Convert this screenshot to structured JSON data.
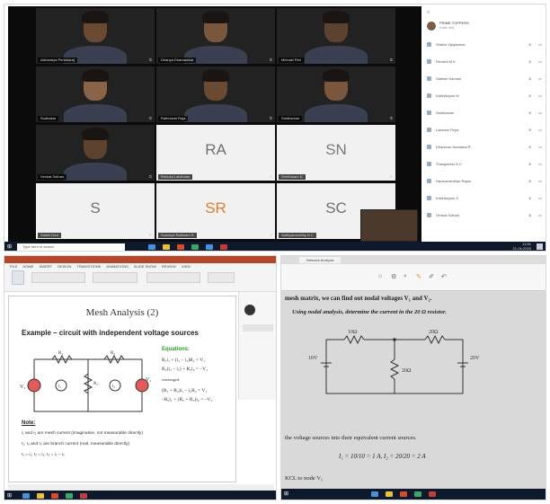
{
  "meeting": {
    "tiles": [
      {
        "label": "Aishwarya Perinbaraj",
        "initials": ""
      },
      {
        "label": "Dhanya Dhanasekar",
        "initials": ""
      },
      {
        "label": "Michael Rini",
        "initials": ""
      },
      {
        "label": "Sudhakar",
        "initials": ""
      },
      {
        "label": "Rathnavel Raja",
        "initials": ""
      },
      {
        "label": "Saidharsan",
        "initials": ""
      },
      {
        "label": "Venkat Suthan",
        "initials": ""
      },
      {
        "label": "Renuka Lakshnan",
        "initials": "RA"
      },
      {
        "label": "Seetharam N",
        "initials": "SN"
      },
      {
        "label": "Sakthi Devi",
        "initials": "S"
      },
      {
        "label": "Sowmya Rathnam R",
        "initials": "SR"
      },
      {
        "label": "Sathiyamoorthy N C",
        "initials": "SC"
      }
    ],
    "initial_colors": {
      "RA": "#6f6f6f",
      "SN": "#7a7a7a",
      "S": "#6f6f6f",
      "SR": "#e07b2f",
      "SC": "#6f6f6f"
    },
    "participants_header": "PRIME TOPPERS",
    "participants_sub": "(Host, me)",
    "participants": [
      "Shalini Vijaykumar",
      "Revathi M K",
      "Sathish Kannan",
      "Karthikeyan M",
      "Saidharsan",
      "Lakshmi Priya",
      "Dharshan Nandana R",
      "Thangavelu N C",
      "Harshavardhan Rajan",
      "Karthikeyan S",
      "Venkat Suthan"
    ],
    "taskbar_search": "Type here to search",
    "clock_time": "11:51",
    "clock_date": "21-04-2020"
  },
  "slide": {
    "ribbon_tabs": [
      "FILE",
      "HOME",
      "INSERT",
      "DESIGN",
      "TRANSITIONS",
      "ANIMATIONS",
      "SLIDE SHOW",
      "REVIEW",
      "VIEW"
    ],
    "title": "Mesh Analysis (2)",
    "example": "Example – circuit with independent voltage sources",
    "equations_heading": "Equations:",
    "equations": [
      "R₁i₁ + (i₁ – i₂)R₂ = V₁",
      "R₂(i₂ – i₁) + R₃i₂ = –V₂",
      "rearranged:",
      "(R₁ + R₂)i₁ – i₂R₂ = V₁",
      "–R₂i₁ + (R₂ + R₃)i₂ = –V₂"
    ],
    "note_heading": "Note:",
    "notes": [
      "i₁ and i₂ are mesh current (imaginative, not measurable directly)",
      "I₁, I₂ and I₃ are branch current (real, measurable directly)",
      "I₁ = i₁;  I₂ = i₂;  I₃ = i₁ – i₂"
    ],
    "circuit": {
      "v1": "V₁",
      "v2": "V₂",
      "r1": "R₁",
      "r2": "R₂",
      "r3": "R₃",
      "i1": "i₁",
      "i2": "i₂"
    }
  },
  "document": {
    "tab": "Network Analysis",
    "lines": [
      "mesh matrix, we can find out nodal voltages V₁ and V₂.",
      "Using nodal analysis, determine the current in the 20 Ω resistor."
    ],
    "circuit": {
      "r_left": "10Ω",
      "r_right": "20Ω",
      "r_mid": "20Ω",
      "v_left": "10V",
      "v_right": "20V"
    },
    "lower_lines": [
      "the voltage sources into their equivalent current sources.",
      "I₁ = 10/10 = 1 A, I₂ = 20/20 = 2 A",
      "KCL to node V₁"
    ]
  }
}
